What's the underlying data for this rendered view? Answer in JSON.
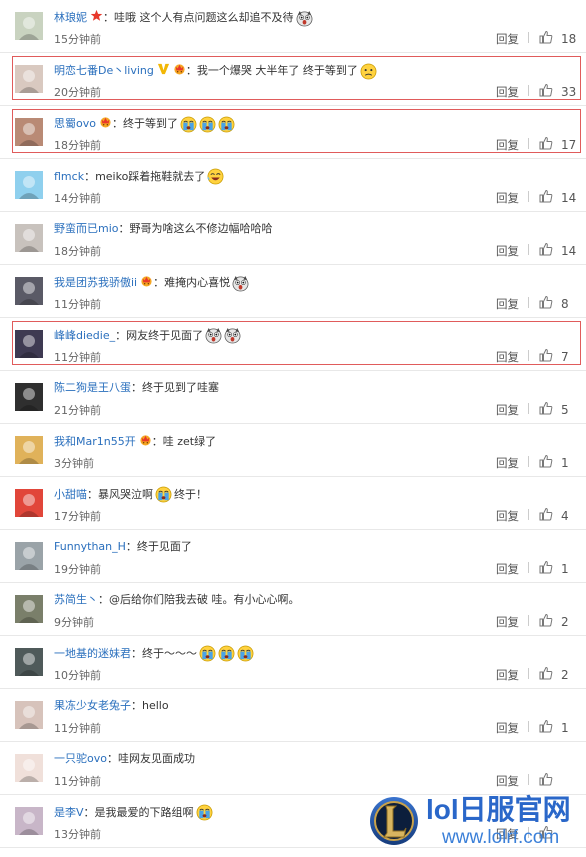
{
  "comments": [
    {
      "user": "林琅妮",
      "badge": "star-badge",
      "text": "哇哦 这个人有点问题这么却追不及待",
      "emojis": [
        "shocked-dog-emoji"
      ],
      "time": "15分钟前",
      "reply": "回复",
      "likes": "18",
      "highlight": false,
      "avatar_color": "#c9d3c0"
    },
    {
      "user": "明恋七番De丶living",
      "badge": "vip-badge",
      "badge2": "crown-badge",
      "text": "我一个爆哭 大半年了 终于等到了",
      "emojis": [
        "sad-emoji"
      ],
      "time": "20分钟前",
      "reply": "回复",
      "likes": "33",
      "highlight": true,
      "avatar_color": "#d9c9c0"
    },
    {
      "user": "思蜀ovo",
      "badge": "crown-badge",
      "text": "终于等到了",
      "emojis": [
        "crying-emoji",
        "crying-emoji",
        "crying-emoji"
      ],
      "time": "18分钟前",
      "reply": "回复",
      "likes": "17",
      "highlight": true,
      "avatar_color": "#b98a75"
    },
    {
      "user": "flmck",
      "badge": "",
      "text": "meiko踩着拖鞋就去了",
      "emojis": [
        "laughing-emoji"
      ],
      "time": "14分钟前",
      "reply": "回复",
      "likes": "14",
      "highlight": false,
      "avatar_color": "#8fd0ee"
    },
    {
      "user": "野蛮而已mio",
      "badge": "",
      "text": "野哥为啥这么不修边幅哈哈哈",
      "emojis": [],
      "time": "18分钟前",
      "reply": "回复",
      "likes": "14",
      "highlight": false,
      "avatar_color": "#c8c2bd"
    },
    {
      "user": "我是团苏我骄傲ii",
      "badge": "crown-badge",
      "text": "难掩内心喜悦",
      "emojis": [
        "shocked-dog-emoji"
      ],
      "time": "11分钟前",
      "reply": "回复",
      "likes": "8",
      "highlight": false,
      "avatar_color": "#5a5a66"
    },
    {
      "user": "峰峰diedie_",
      "badge": "",
      "text": "网友终于见面了",
      "emojis": [
        "shocked-dog-emoji",
        "shocked-dog-emoji"
      ],
      "time": "11分钟前",
      "reply": "回复",
      "likes": "7",
      "highlight": true,
      "avatar_color": "#3e3a52"
    },
    {
      "user": "陈二狗是王八蛋",
      "badge": "",
      "text": "终于见到了哇塞",
      "emojis": [],
      "time": "21分钟前",
      "reply": "回复",
      "likes": "5",
      "highlight": false,
      "avatar_color": "#2f2f2f"
    },
    {
      "user": "我和Mar1n55开",
      "badge": "crown-badge",
      "text": "哇 zet绿了",
      "emojis": [],
      "time": "3分钟前",
      "reply": "回复",
      "likes": "1",
      "highlight": false,
      "avatar_color": "#e0b25a"
    },
    {
      "user": "小甜喵",
      "badge": "",
      "text": "暴风哭泣啊",
      "text2": "终于！",
      "emojis": [
        "crying-emoji"
      ],
      "time": "17分钟前",
      "reply": "回复",
      "likes": "4",
      "highlight": false,
      "avatar_color": "#e1463a"
    },
    {
      "user": "Funnythan_H",
      "badge": "",
      "text": "终于见面了",
      "emojis": [],
      "time": "19分钟前",
      "reply": "回复",
      "likes": "1",
      "highlight": false,
      "avatar_color": "#9aa3a8"
    },
    {
      "user": "苏简生丶",
      "badge": "",
      "text": "@后给你们陪我去破  哇。有小心心啊。",
      "emojis": [],
      "time": "9分钟前",
      "reply": "回复",
      "likes": "2",
      "highlight": false,
      "avatar_color": "#7a7f6a"
    },
    {
      "user": "一地基的迷妹君",
      "badge": "",
      "text": "终于～～～",
      "emojis": [
        "crying-emoji",
        "crying-emoji",
        "crying-emoji"
      ],
      "time": "10分钟前",
      "reply": "回复",
      "likes": "2",
      "highlight": false,
      "avatar_color": "#4f5a5a"
    },
    {
      "user": "果冻少女老兔子",
      "badge": "",
      "text": "hello",
      "emojis": [],
      "time": "11分钟前",
      "reply": "回复",
      "likes": "1",
      "highlight": false,
      "avatar_color": "#d7c3bb"
    },
    {
      "user": "一只驼ovo",
      "badge": "",
      "text": "哇网友见面成功",
      "emojis": [],
      "time": "11分钟前",
      "reply": "回复",
      "likes": "",
      "highlight": false,
      "avatar_color": "#f0e0da"
    },
    {
      "user": "是李V",
      "badge": "",
      "text": "是我最爱的下路组啊",
      "emojis": [
        "crying-emoji"
      ],
      "time": "13分钟前",
      "reply": "回复",
      "likes": "",
      "highlight": false,
      "avatar_color": "#c8b6c8"
    }
  ],
  "separator": "：",
  "watermark": {
    "title": "lol日服官网",
    "url": "www.lolrf.com",
    "emblem_letter": "L"
  },
  "colors": {
    "username": "#2a6fbd",
    "highlight_border": "#e05b5b",
    "watermark_blue": "#2a67c9"
  }
}
